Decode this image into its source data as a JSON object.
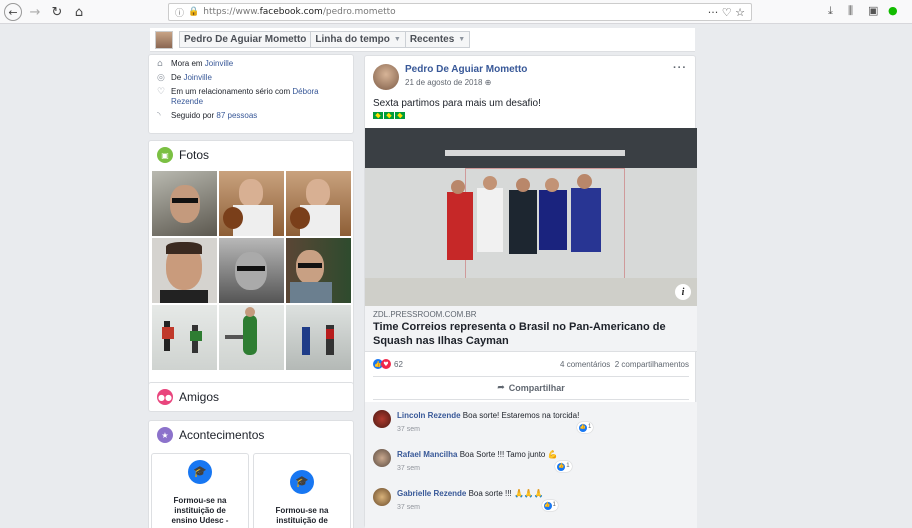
{
  "browser": {
    "url_prefix": "https://www.",
    "url_host": "facebook.com",
    "url_path": "/pedro.mometto",
    "menu_dots": "···"
  },
  "timeline_bar": {
    "name": "Pedro De Aguiar Mometto",
    "timeline_label": "Linha do tempo",
    "recent_label": "Recentes"
  },
  "intro": {
    "lives_prefix": "Mora em ",
    "lives_city": "Joinville",
    "from_prefix": "De ",
    "from_city": "Joinville",
    "relationship_prefix": "Em um relacionamento sério com ",
    "relationship_partner": "Débora Rezende",
    "followed_prefix": "Seguido por ",
    "followers": "87 pessoas"
  },
  "photos": {
    "title": "Fotos"
  },
  "friends": {
    "title": "Amigos"
  },
  "events": {
    "title": "Acontecimentos",
    "tiles": [
      {
        "line1": "Formou-se na",
        "line2": "instituição de",
        "line3": "ensino Udesc -",
        "line4": ""
      },
      {
        "line1": "",
        "line2": "Formou-se na",
        "line3": "instituição de",
        "line4": ""
      }
    ]
  },
  "post": {
    "author": "Pedro De Aguiar Mometto",
    "time": "21 de agosto de 2018",
    "text": "Sexta partimos para mais um desafio!",
    "link_domain": "ZDL.PRESSROOM.COM.BR",
    "link_title": "Time Correios representa o Brasil no Pan-Americano de Squash nas Ilhas Cayman",
    "reactions_count": "62",
    "comments_count": "4 comentários",
    "shares_count": "2 compartilhamentos",
    "share_label": "Compartilhar"
  },
  "comments": [
    {
      "author": "Lincoln Rezende",
      "text": "Boa sorte! Estaremos na torcida!",
      "time": "37 sem",
      "likes": "1"
    },
    {
      "author": "Rafael Mancilha",
      "text": "Boa Sorte !!! Tamo junto",
      "emoji": "💪",
      "time": "37 sem",
      "likes": "1"
    },
    {
      "author": "Gabrielle Rezende",
      "text": "Boa sorte !!!",
      "emoji": "🙏🙏🙏",
      "time": "37 sem",
      "likes": "1"
    }
  ],
  "colors": {
    "facebook_blue": "#385898",
    "page_bg": "#e9ebee",
    "like_blue": "#1877f2",
    "love_red": "#f0284a"
  }
}
